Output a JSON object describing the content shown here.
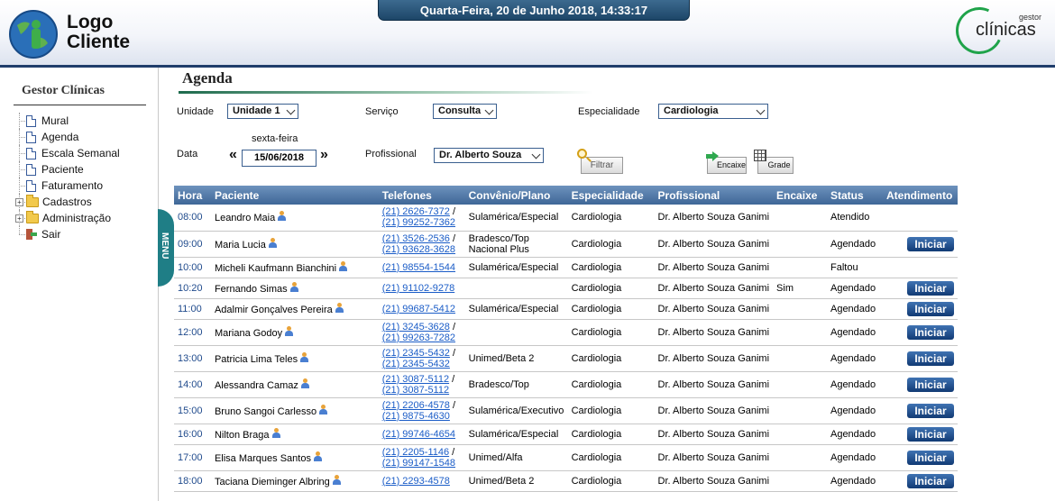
{
  "header": {
    "logo_line1": "Logo",
    "logo_line2": "Cliente",
    "datetime": "Quarta-Feira, 20 de Junho 2018, 14:33:17",
    "brand_small": "gestor",
    "brand_big": "clínicas"
  },
  "sidebar": {
    "title": "Gestor Clínicas",
    "items": [
      {
        "label": "Mural",
        "icon": "document-icon"
      },
      {
        "label": "Agenda",
        "icon": "document-icon"
      },
      {
        "label": "Escala Semanal",
        "icon": "document-icon"
      },
      {
        "label": "Paciente",
        "icon": "document-icon"
      },
      {
        "label": "Faturamento",
        "icon": "document-icon"
      },
      {
        "label": "Cadastros",
        "icon": "folder-icon"
      },
      {
        "label": "Administração",
        "icon": "folder-icon"
      },
      {
        "label": "Sair",
        "icon": "exit-icon"
      }
    ],
    "menu_tab": "MENU"
  },
  "page": {
    "title": "Agenda"
  },
  "filters": {
    "unidade_label": "Unidade",
    "unidade_value": "Unidade 1",
    "servico_label": "Serviço",
    "servico_value": "Consulta",
    "especialidade_label": "Especialidade",
    "especialidade_value": "Cardiologia",
    "data_label": "Data",
    "weekday": "sexta-feira",
    "date_value": "15/06/2018",
    "prev_glyph": "«",
    "next_glyph": "»",
    "profissional_label": "Profissional",
    "profissional_value": "Dr. Alberto Souza"
  },
  "buttons": {
    "filtrar": "Filtrar",
    "encaixe": "Encaixe",
    "grade": "Grade"
  },
  "table": {
    "headers": [
      "Hora",
      "Paciente",
      "Telefones",
      "Convênio/Plano",
      "Especialidade",
      "Profissional",
      "Encaixe",
      "Status",
      "Atendimento"
    ],
    "action_label": "Iniciar",
    "rows": [
      {
        "hora": "08:00",
        "paciente": "Leandro Maia",
        "phones": [
          "(21) 2626-7372",
          "(21) 99252-7362"
        ],
        "convenio": [
          "Sulamérica/Especial"
        ],
        "especialidade": "Cardiologia",
        "profissional": "Dr. Alberto Souza Ganimi",
        "encaixe": "",
        "status": "Atendido",
        "action": false
      },
      {
        "hora": "09:00",
        "paciente": "Maria Lucia",
        "phones": [
          "(21) 3526-2536",
          "(21) 93628-3628"
        ],
        "convenio": [
          "Bradesco/Top",
          "Nacional Plus"
        ],
        "especialidade": "Cardiologia",
        "profissional": "Dr. Alberto Souza Ganimi",
        "encaixe": "",
        "status": "Agendado",
        "action": true
      },
      {
        "hora": "10:00",
        "paciente": "Micheli Kaufmann Bianchini",
        "phones": [
          "(21) 98554-1544"
        ],
        "convenio": [
          "Sulamérica/Especial"
        ],
        "especialidade": "Cardiologia",
        "profissional": "Dr. Alberto Souza Ganimi",
        "encaixe": "",
        "status": "Faltou",
        "action": false
      },
      {
        "hora": "10:20",
        "paciente": "Fernando Simas",
        "phones": [
          "(21) 91102-9278"
        ],
        "convenio": [],
        "especialidade": "Cardiologia",
        "profissional": "Dr. Alberto Souza Ganimi",
        "encaixe": "Sim",
        "status": "Agendado",
        "action": true
      },
      {
        "hora": "11:00",
        "paciente": "Adalmir Gonçalves Pereira",
        "phones": [
          "(21) 99687-5412"
        ],
        "convenio": [
          "Sulamérica/Especial"
        ],
        "especialidade": "Cardiologia",
        "profissional": "Dr. Alberto Souza Ganimi",
        "encaixe": "",
        "status": "Agendado",
        "action": true
      },
      {
        "hora": "12:00",
        "paciente": "Mariana Godoy",
        "phones": [
          "(21) 3245-3628",
          "(21) 99263-7282"
        ],
        "convenio": [],
        "especialidade": "Cardiologia",
        "profissional": "Dr. Alberto Souza Ganimi",
        "encaixe": "",
        "status": "Agendado",
        "action": true
      },
      {
        "hora": "13:00",
        "paciente": "Patricia Lima Teles",
        "phones": [
          "(21) 2345-5432",
          "(21) 2345-5432"
        ],
        "convenio": [
          "Unimed/Beta 2"
        ],
        "especialidade": "Cardiologia",
        "profissional": "Dr. Alberto Souza Ganimi",
        "encaixe": "",
        "status": "Agendado",
        "action": true
      },
      {
        "hora": "14:00",
        "paciente": "Alessandra Camaz",
        "phones": [
          "(21) 3087-5112",
          "(21) 3087-5112"
        ],
        "convenio": [
          "Bradesco/Top"
        ],
        "especialidade": "Cardiologia",
        "profissional": "Dr. Alberto Souza Ganimi",
        "encaixe": "",
        "status": "Agendado",
        "action": true
      },
      {
        "hora": "15:00",
        "paciente": "Bruno Sangoi Carlesso",
        "phones": [
          "(21) 2206-4578",
          "(21) 9875-4630"
        ],
        "convenio": [
          "Sulamérica/Executivo"
        ],
        "especialidade": "Cardiologia",
        "profissional": "Dr. Alberto Souza Ganimi",
        "encaixe": "",
        "status": "Agendado",
        "action": true
      },
      {
        "hora": "16:00",
        "paciente": "Nilton Braga",
        "phones": [
          "(21) 99746-4654"
        ],
        "convenio": [
          "Sulamérica/Especial"
        ],
        "especialidade": "Cardiologia",
        "profissional": "Dr. Alberto Souza Ganimi",
        "encaixe": "",
        "status": "Agendado",
        "action": true
      },
      {
        "hora": "17:00",
        "paciente": "Elisa Marques Santos",
        "phones": [
          "(21) 2205-1146",
          "(21) 99147-1548"
        ],
        "convenio": [
          "Unimed/Alfa"
        ],
        "especialidade": "Cardiologia",
        "profissional": "Dr. Alberto Souza Ganimi",
        "encaixe": "",
        "status": "Agendado",
        "action": true
      },
      {
        "hora": "18:00",
        "paciente": "Taciana Dieminger Albring",
        "phones": [
          "(21) 2293-4578"
        ],
        "convenio": [
          "Unimed/Beta 2"
        ],
        "especialidade": "Cardiologia",
        "profissional": "Dr. Alberto Souza Ganimi",
        "encaixe": "",
        "status": "Agendado",
        "action": true
      }
    ]
  },
  "colors": {
    "header_bar": "#1d4668",
    "table_header": "#4f77a5",
    "link": "#1a5cc7",
    "button": "#1d4e8f",
    "brand_green": "#1fa34a"
  }
}
